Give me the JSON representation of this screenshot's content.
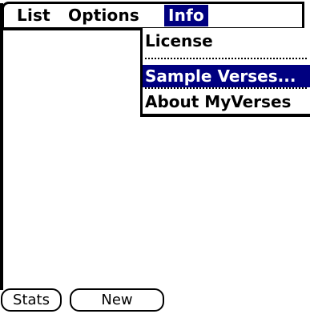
{
  "menu": {
    "list_label": "List",
    "options_label": "Options",
    "info_label": "Info"
  },
  "dropdown": {
    "items": [
      {
        "label": "License",
        "selected": false
      },
      {
        "label": "Sample Verses...",
        "selected": true
      },
      {
        "label": "About MyVerses",
        "selected": false
      }
    ]
  },
  "buttons": {
    "stats_label": "Stats",
    "new_label": "New"
  },
  "colors": {
    "highlight": "#000080",
    "background": "#ffffff",
    "foreground": "#000000"
  }
}
